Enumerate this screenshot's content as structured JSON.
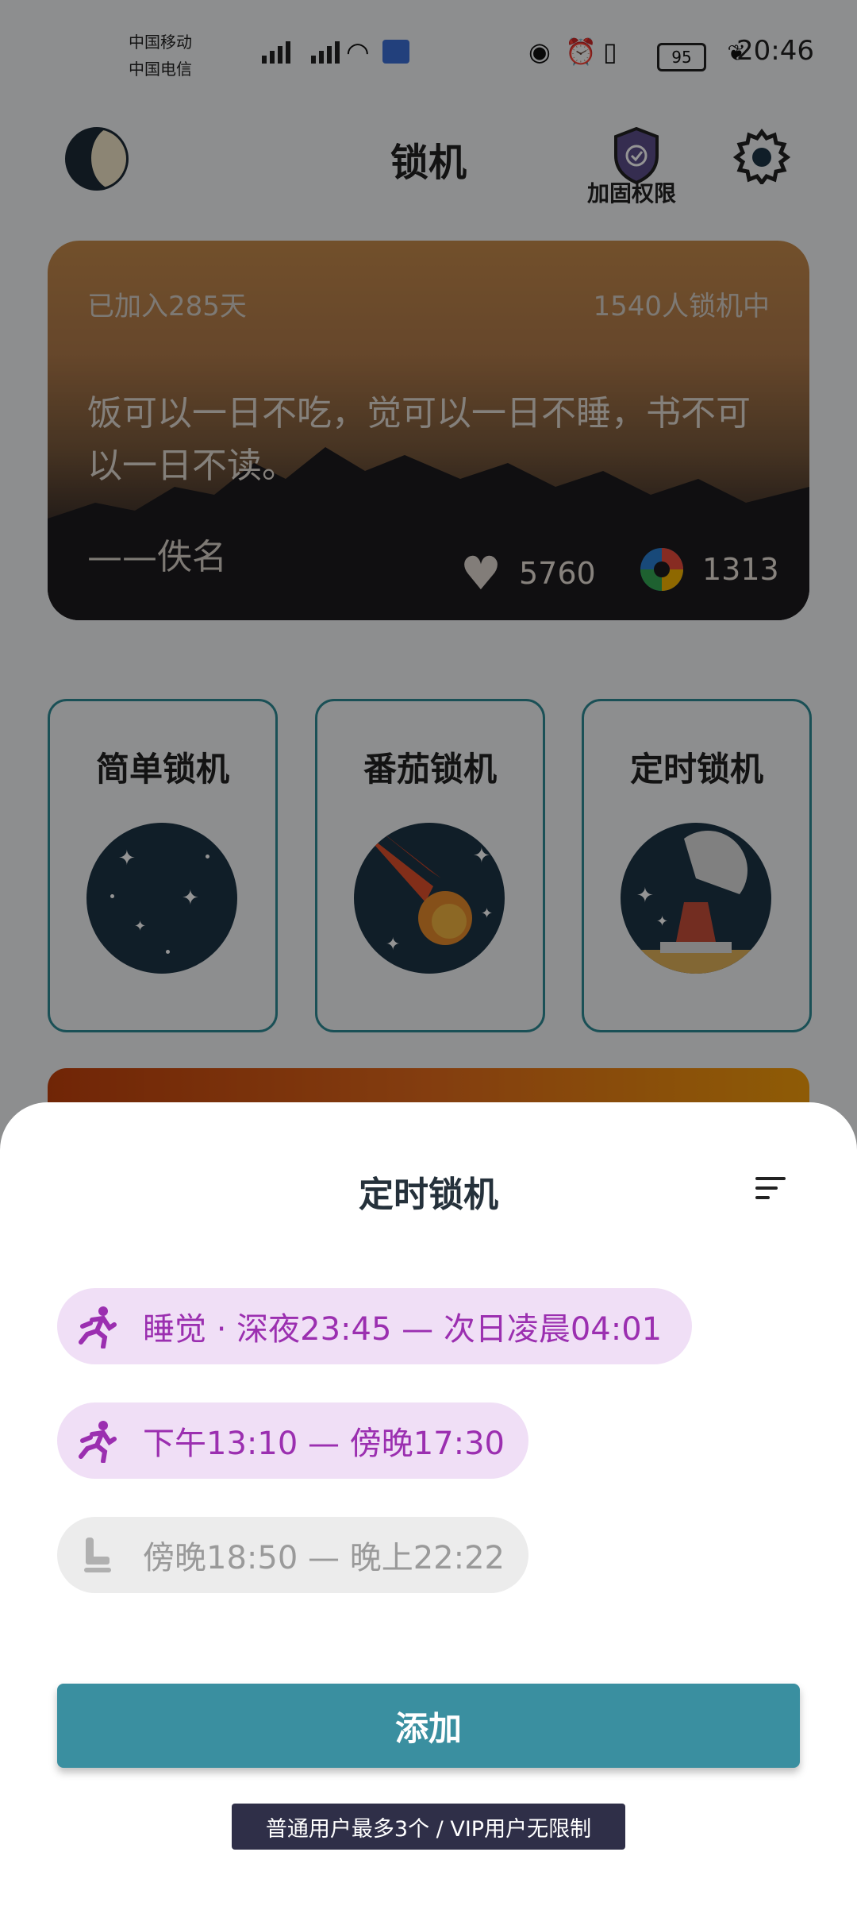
{
  "status_bar": {
    "carrier1": "中国移动",
    "carrier2": "中国电信",
    "battery": "95",
    "time": "20:46"
  },
  "header": {
    "title": "锁机",
    "shield_label": "加固权限"
  },
  "card": {
    "joined": "已加入285天",
    "online": "1540人锁机中",
    "quote": "饭可以一日不吃，觉可以一日不睡，书不可以一日不读。",
    "author": "——佚名",
    "likes": "5760",
    "shots": "1313"
  },
  "modes": [
    {
      "label": "简单锁机"
    },
    {
      "label": "番茄锁机"
    },
    {
      "label": "定时锁机"
    }
  ],
  "sheet": {
    "title": "定时锁机",
    "schedules": [
      {
        "text": "睡觉 · 深夜23:45 — 次日凌晨04:01",
        "active": true,
        "icon": "running-icon"
      },
      {
        "text": "下午13:10 — 傍晚17:30",
        "active": true,
        "icon": "running-icon"
      },
      {
        "text": "傍晚18:50 — 晚上22:22",
        "active": false,
        "icon": "seat-icon"
      }
    ],
    "add_label": "添加",
    "limit_note": "普通用户最多3个 / VIP用户无限制"
  },
  "colors": {
    "accent": "#3a8fa0",
    "pill_active_bg": "#f0dff6",
    "pill_active_text": "#9b2fb0"
  }
}
